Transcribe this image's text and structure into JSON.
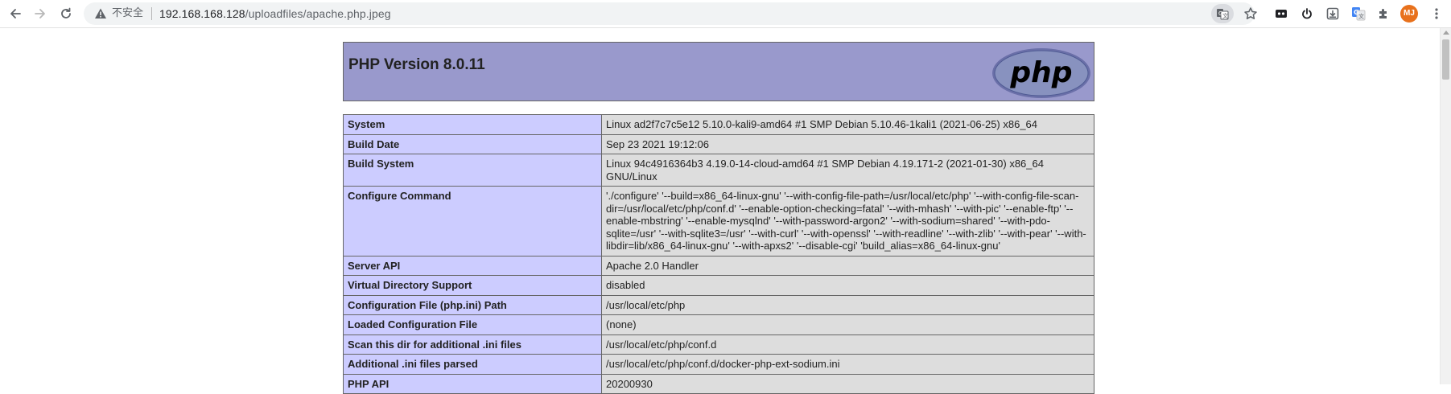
{
  "browser": {
    "address_bar": {
      "security_label": "不安全",
      "url_host": "192.168.168.128",
      "url_path": "/uploadfiles/apache.php.jpeg"
    },
    "profile_initials": "MJ",
    "icons": [
      "back-icon",
      "forward-icon",
      "reload-icon",
      "warning-icon",
      "translate-icon",
      "star-icon",
      "extension-icon",
      "power-icon",
      "download-icon",
      "google-translate-icon",
      "puzzle-icon",
      "menu-icon"
    ]
  },
  "phpinfo": {
    "header": {
      "title": "PHP Version 8.0.11",
      "logo_text": "php"
    },
    "rows": [
      {
        "key": "System",
        "value": "Linux ad2f7c7c5e12 5.10.0-kali9-amd64 #1 SMP Debian 5.10.46-1kali1 (2021-06-25) x86_64"
      },
      {
        "key": "Build Date",
        "value": "Sep 23 2021 19:12:06"
      },
      {
        "key": "Build System",
        "value": "Linux 94c4916364b3 4.19.0-14-cloud-amd64 #1 SMP Debian 4.19.171-2 (2021-01-30) x86_64 GNU/Linux"
      },
      {
        "key": "Configure Command",
        "value": "'./configure' '--build=x86_64-linux-gnu' '--with-config-file-path=/usr/local/etc/php' '--with-config-file-scan-dir=/usr/local/etc/php/conf.d' '--enable-option-checking=fatal' '--with-mhash' '--with-pic' '--enable-ftp' '--enable-mbstring' '--enable-mysqlnd' '--with-password-argon2' '--with-sodium=shared' '--with-pdo-sqlite=/usr' '--with-sqlite3=/usr' '--with-curl' '--with-openssl' '--with-readline' '--with-zlib' '--with-pear' '--with-libdir=lib/x86_64-linux-gnu' '--with-apxs2' '--disable-cgi' 'build_alias=x86_64-linux-gnu'"
      },
      {
        "key": "Server API",
        "value": "Apache 2.0 Handler"
      },
      {
        "key": "Virtual Directory Support",
        "value": "disabled"
      },
      {
        "key": "Configuration File (php.ini) Path",
        "value": "/usr/local/etc/php"
      },
      {
        "key": "Loaded Configuration File",
        "value": "(none)"
      },
      {
        "key": "Scan this dir for additional .ini files",
        "value": "/usr/local/etc/php/conf.d"
      },
      {
        "key": "Additional .ini files parsed",
        "value": "/usr/local/etc/php/conf.d/docker-php-ext-sodium.ini"
      },
      {
        "key": "PHP API",
        "value": "20200930"
      }
    ]
  },
  "colors": {
    "header_bg": "#9999cc",
    "key_cell_bg": "#ccccff",
    "value_cell_bg": "#dddddd",
    "border": "#666666",
    "avatar_bg": "#e8711c"
  }
}
